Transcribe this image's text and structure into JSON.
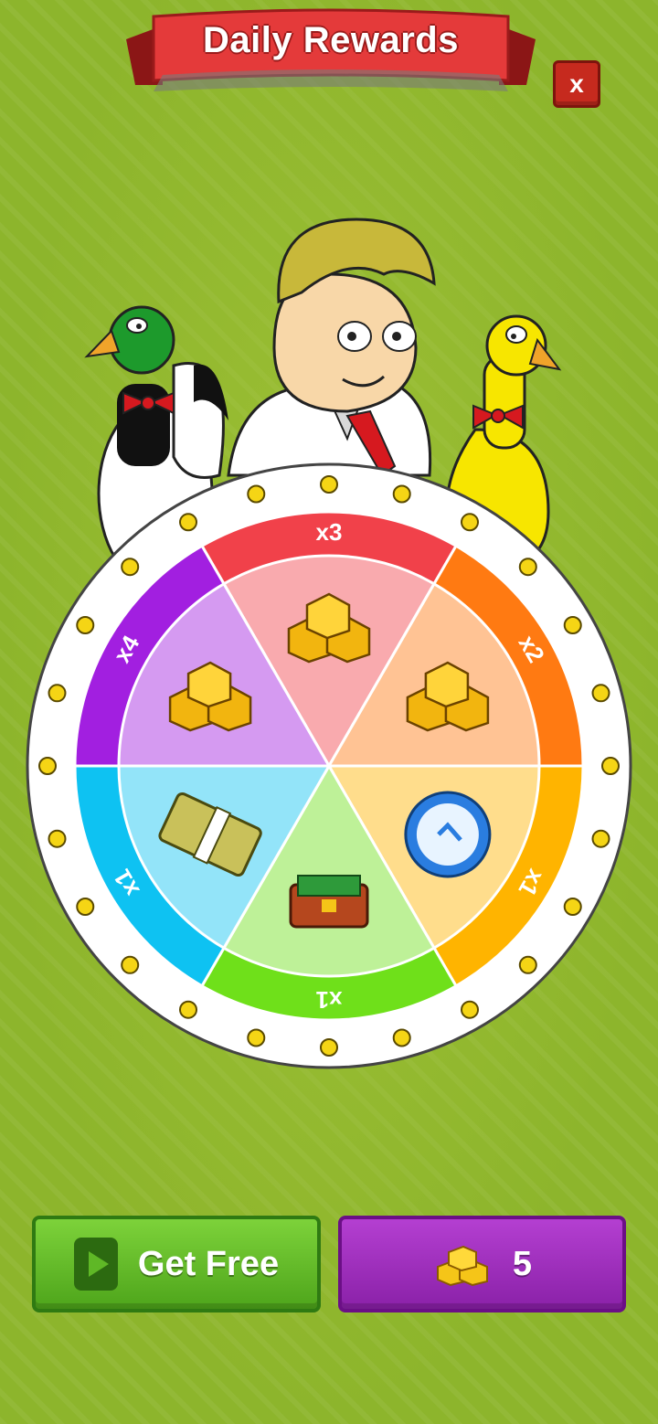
{
  "header": {
    "title": "Daily Rewards",
    "close_label": "x"
  },
  "wheel": {
    "segments": [
      {
        "label": "x3",
        "reward_icon": "gold-bars-stack-icon",
        "color": "#f1414a"
      },
      {
        "label": "x2",
        "reward_icon": "gold-bars-icon",
        "color": "#ff7a12"
      },
      {
        "label": "x1",
        "reward_icon": "clock-icon",
        "color": "#ffb400"
      },
      {
        "label": "x1",
        "reward_icon": "money-chest-icon",
        "color": "#6fe01a"
      },
      {
        "label": "x1",
        "reward_icon": "cash-bundle-icon",
        "color": "#0ec2f2"
      },
      {
        "label": "x4",
        "reward_icon": "gold-bars-icon",
        "color": "#a21fe0"
      }
    ]
  },
  "characters": [
    "green-head-duck",
    "man-in-white-suit",
    "yellow-duck"
  ],
  "buttons": {
    "get_free_label": "Get Free",
    "buy_price": "5"
  },
  "colors": {
    "background": "#8db52c",
    "banner": "#e43a3a",
    "get_free": "#5cb824",
    "buy": "#9a2bbb"
  }
}
